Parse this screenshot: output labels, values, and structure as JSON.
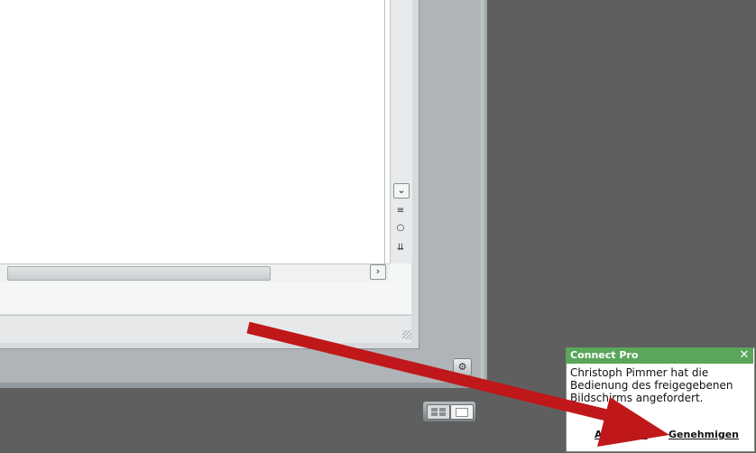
{
  "pod": {
    "scroll_down_icon": "chevron-down-icon",
    "scroll_right_icon": "chevron-right-icon",
    "options_icon": "gear-icon"
  },
  "icons": {
    "scroll_down": "⌄",
    "more": "≡",
    "circle": "○",
    "end": "⇊",
    "scroll_right": "›",
    "options": "⚙"
  },
  "layout_switcher": {
    "grid_icon": "grid-layout-icon",
    "single_icon": "single-layout-icon"
  },
  "notification": {
    "title": "Connect Pro",
    "close": "✕",
    "message": "Christoph Pimmer hat die Bedienung des freigegebenen Bildschirms angefordert.",
    "reject_label": "Ablehnen",
    "approve_label": "Genehmigen"
  },
  "colors": {
    "notification_header": "#5aa65a",
    "arrow": "#c0181a",
    "background": "#5f5f5f"
  }
}
